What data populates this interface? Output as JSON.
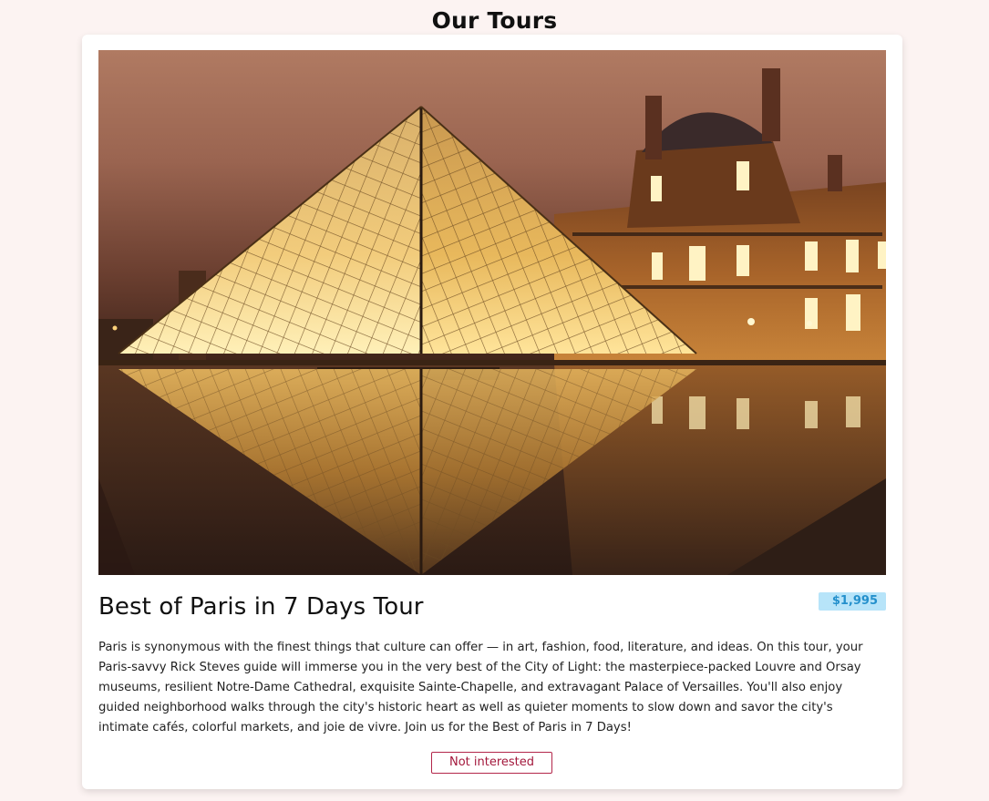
{
  "page": {
    "title": "Our Tours"
  },
  "tour": {
    "image_subject": "Louvre pyramid at night",
    "name": "Best of Paris in 7 Days Tour",
    "price": "$1,995",
    "description": "Paris is synonymous with the finest things that culture can offer — in art, fashion, food, literature, and ideas. On this tour, your Paris-savvy Rick Steves guide will immerse you in the very best of the City of Light: the masterpiece-packed Louvre and Orsay museums, resilient Notre-Dame Cathedral, exquisite Sainte-Chapelle, and extravagant Palace of Versailles. You'll also enjoy guided neighborhood walks through the city's historic heart as well as quieter moments to slow down and savor the city's intimate cafés, colorful markets, and joie de vivre. Join us for the Best of Paris in 7 Days!",
    "button_label": "Not interested"
  },
  "colors": {
    "page_background": "#fcf3f2",
    "card_background": "#ffffff",
    "price_badge_background": "#b7e4f9",
    "price_badge_text": "#2490cc",
    "button_accent": "#a3183c"
  }
}
